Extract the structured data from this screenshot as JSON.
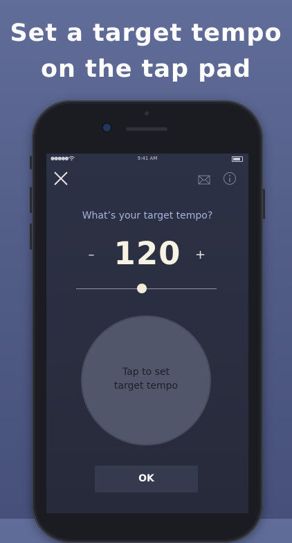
{
  "headline": {
    "line1": "Set a target tempo",
    "line2": "on the tap pad"
  },
  "statusbar": {
    "signal": "●●●●●",
    "time": "9:41 AM"
  },
  "toolbar": {
    "close_icon": "close-icon",
    "mail_icon": "mail-icon",
    "info_icon": "info-icon"
  },
  "prompt": {
    "question": "What’s your target tempo?"
  },
  "tempo": {
    "value": "120",
    "decrement_label": "–",
    "increment_label": "+",
    "slider_fraction": 0.47
  },
  "tap_pad": {
    "line1": "Tap to set",
    "line2": "target tempo"
  },
  "ok_button": {
    "label": "OK"
  },
  "colors": {
    "background": "#535e88",
    "screen": "#2a2e40",
    "accent_text": "#a6b4de",
    "tempo_text": "#f7f2e2",
    "pad": "#52566a"
  }
}
